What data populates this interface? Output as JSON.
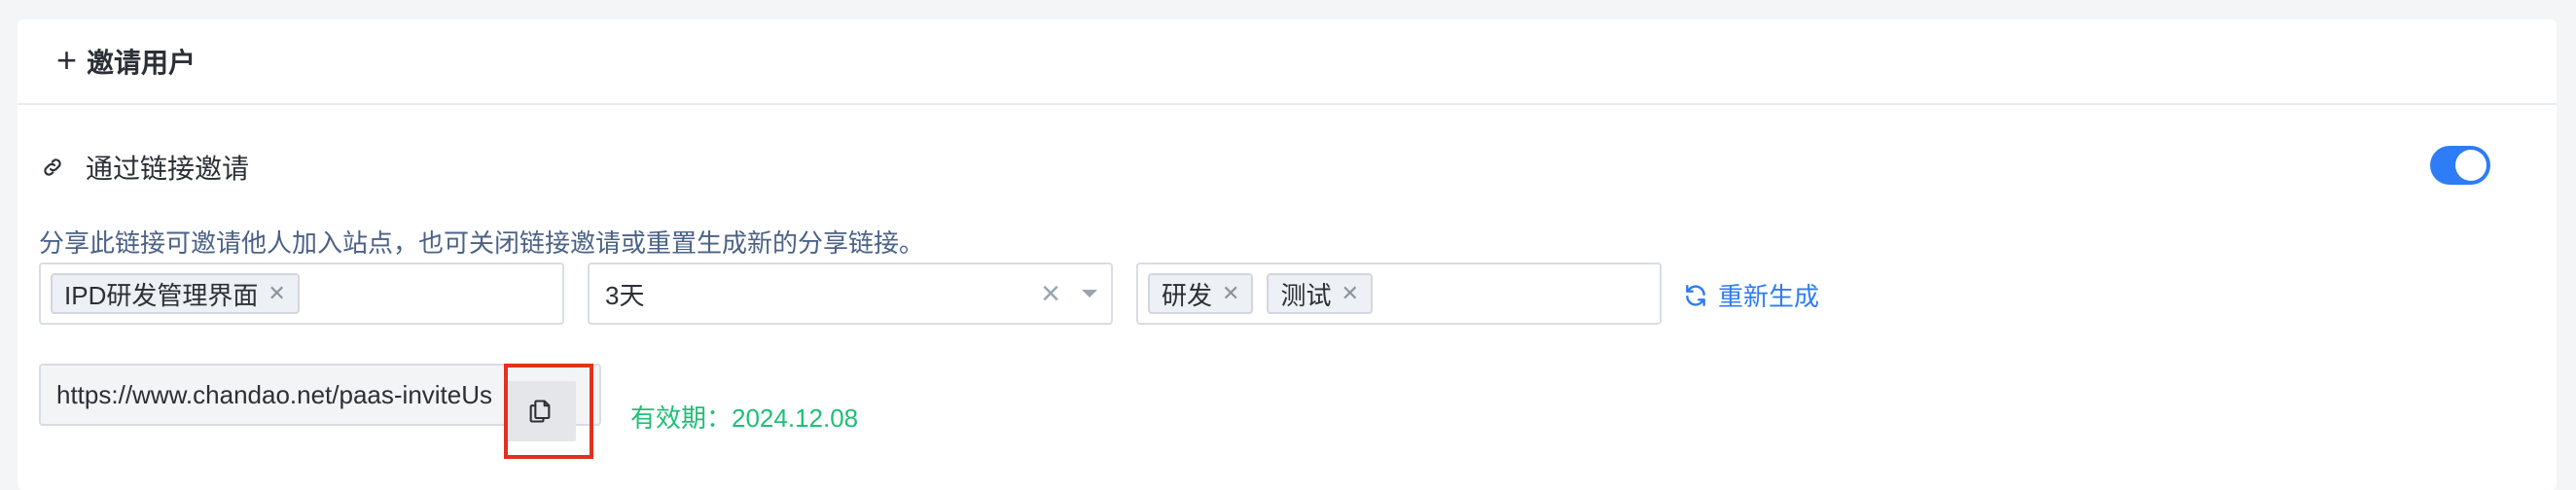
{
  "header": {
    "title": "邀请用户",
    "plus_icon": "+"
  },
  "link_invite": {
    "title": "通过链接邀请",
    "description": "分享此链接可邀请他人加入站点，也可关闭链接邀请或重置生成新的分享链接。",
    "enabled": true,
    "toggle_color": "#2e7cf6"
  },
  "fields": {
    "app_tags": [
      "IPD研发管理界面"
    ],
    "validity": {
      "selected": "3天"
    },
    "role_tags": [
      "研发",
      "测试"
    ]
  },
  "regenerate_label": "重新生成",
  "link": {
    "url": "https://www.chandao.net/paas-inviteUs",
    "expiry": "有效期：2024.12.08"
  },
  "colors": {
    "accent": "#2e7cf6",
    "success": "#1fbf75",
    "highlight": "#e0321f"
  }
}
